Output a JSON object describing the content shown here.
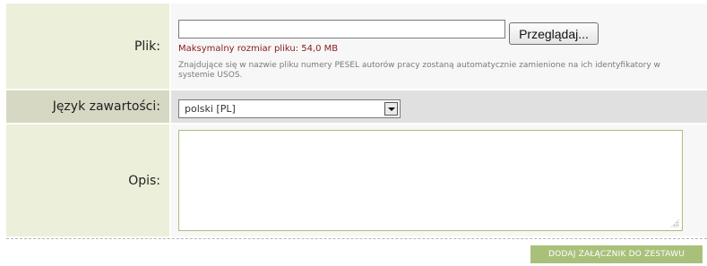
{
  "file_row": {
    "label": "Plik:",
    "file_input_value": "",
    "browse_label": "Przeglądaj...",
    "max_size": "Maksymalny rozmiar pliku: 54,0 MB",
    "hint": "Znajdujące się w nazwie pliku numery PESEL autorów pracy zostaną automatycznie zamienione na ich identyfikatory w systemie USOS."
  },
  "language_row": {
    "label": "Język zawartości:",
    "selected": "polski [PL]"
  },
  "description_row": {
    "label": "Opis:",
    "value": ""
  },
  "footer": {
    "add_button_label": "DODAJ ZAŁĄCZNIK DO ZESTAWU"
  },
  "colors": {
    "label_bg": "#ecefd9",
    "label_bg_alt": "#d6d8c3",
    "accent": "#a9c07a",
    "error_text": "#8b1a1a"
  }
}
